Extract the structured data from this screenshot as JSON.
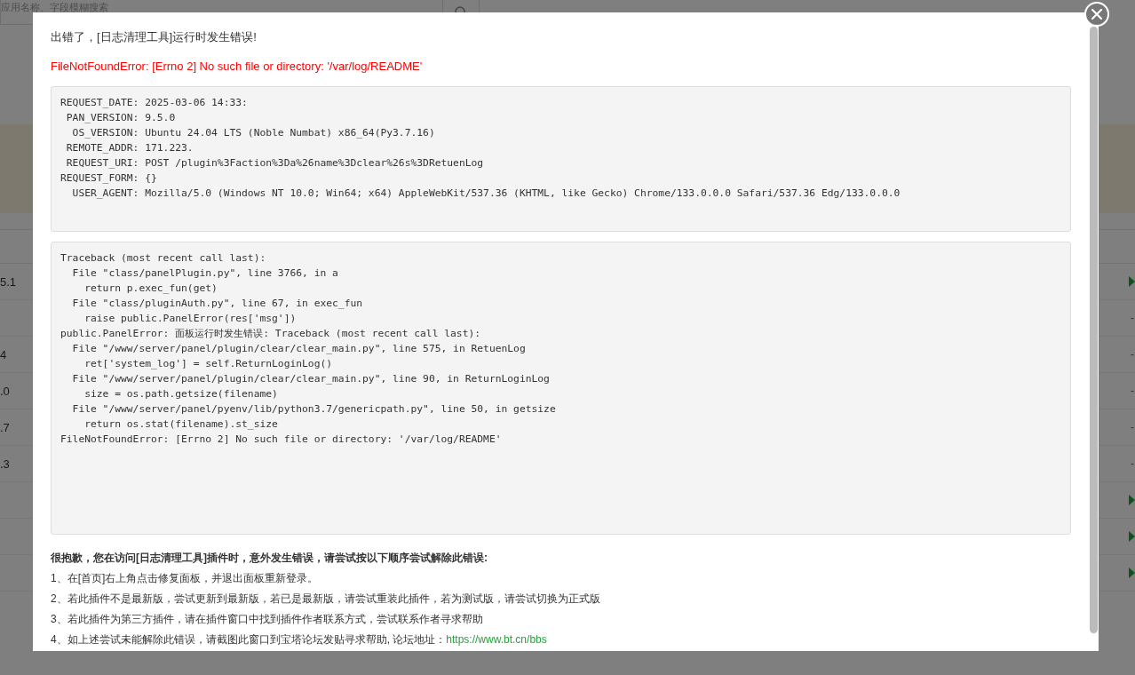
{
  "background": {
    "search_placeholder": "应用名称、字段模糊搜索",
    "rows": [
      {
        "value": "5.1",
        "kind": "play"
      },
      {
        "kind": "dash",
        "status": "-"
      },
      {
        "value": "4",
        "kind": "dash",
        "status": "-"
      },
      {
        "value": ".0",
        "kind": "dash",
        "status": "-"
      },
      {
        "value": ".7",
        "kind": "dash",
        "status": "-"
      },
      {
        "value": ".3",
        "kind": "dash",
        "status": "-"
      },
      {
        "kind": "play"
      },
      {
        "kind": "play"
      },
      {
        "kind": "play"
      }
    ]
  },
  "dialog": {
    "title": "出错了，[日志清理工具]运行时发生错误!",
    "error": "FileNotFoundError: [Errno 2] No such file or directory: '/var/log/README'",
    "request_info": [
      "REQUEST_DATE: 2025-03-06 14:33:",
      " PAN_VERSION: 9.5.0",
      "  OS_VERSION: Ubuntu 24.04 LTS (Noble Numbat) x86_64(Py3.7.16)",
      " REMOTE_ADDR: 171.223.",
      " REQUEST_URI: POST /plugin%3Faction%3Da%26name%3Dclear%26s%3DRetuenLog",
      "REQUEST_FORM: {}",
      "  USER_AGENT: Mozilla/5.0 (Windows NT 10.0; Win64; x64) AppleWebKit/537.36 (KHTML, like Gecko) Chrome/133.0.0.0 Safari/537.36 Edg/133.0.0.0"
    ],
    "traceback": [
      "Traceback (most recent call last):",
      "  File \"class/panelPlugin.py\", line 3766, in a",
      "    return p.exec_fun(get)",
      "  File \"class/pluginAuth.py\", line 67, in exec_fun",
      "    raise public.PanelError(res['msg'])",
      "public.PanelError: 面板运行时发生错误: Traceback (most recent call last):",
      "  File \"/www/server/panel/plugin/clear/clear_main.py\", line 575, in RetuenLog",
      "    ret['system_log'] = self.ReturnLoginLog()",
      "  File \"/www/server/panel/plugin/clear/clear_main.py\", line 90, in ReturnLoginLog",
      "    size = os.path.getsize(filename)",
      "  File \"/www/server/panel/pyenv/lib/python3.7/genericpath.py\", line 50, in getsize",
      "    return os.stat(filename).st_size",
      "FileNotFoundError: [Errno 2] No such file or directory: '/var/log/README'"
    ],
    "help_heading": "很抱歉，您在访问[日志清理工具]插件时，意外发生错误，请尝试按以下顺序尝试解除此错误:",
    "help_steps": [
      "1、在[首页]右上角点击修复面板，并退出面板重新登录。",
      "2、若此插件不是最新版，尝试更新到最新版，若已是最新版，请尝试重装此插件，若为测试版，请尝试切换为正式版",
      "3、若此插件为第三方插件，请在插件窗口中找到插件作者联系方式，尝试联系作者寻求帮助",
      "4、如上述尝试未能解除此错误，请截图此窗口到宝塔论坛发贴寻求帮助, 论坛地址："
    ],
    "help_link": "https://www.bt.cn/bbs"
  }
}
